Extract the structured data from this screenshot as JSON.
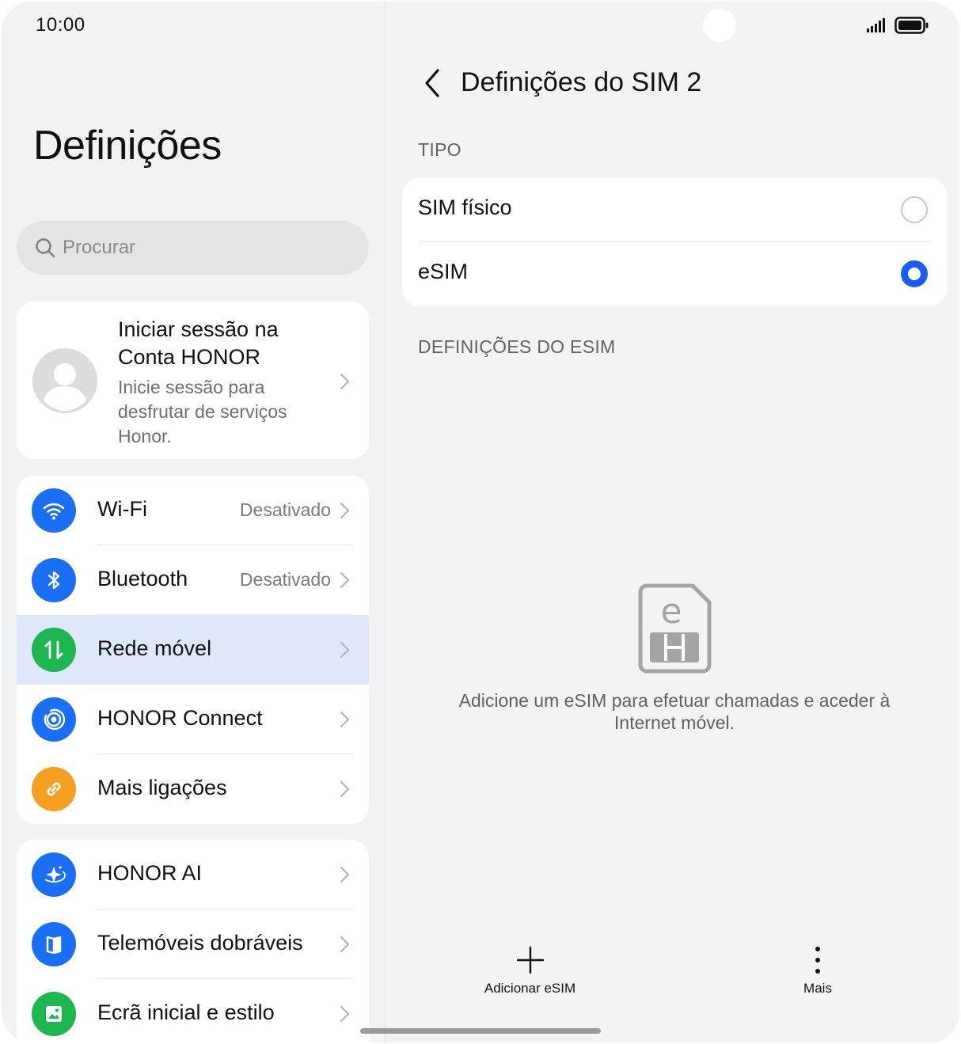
{
  "status_bar": {
    "time": "10:00",
    "signal_icon": "signal-icon",
    "battery_icon": "battery-icon"
  },
  "left": {
    "title": "Definições",
    "search": {
      "placeholder": "Procurar",
      "icon": "search-icon"
    },
    "account": {
      "title": "Iniciar sessão na Conta HONOR",
      "subtitle": "Inicie sessão para desfrutar de serviços Honor.",
      "icon": "avatar-icon"
    },
    "group1": [
      {
        "label": "Wi-Fi",
        "value": "Desativado",
        "icon": "wifi-icon",
        "color": "#1a6ff5"
      },
      {
        "label": "Bluetooth",
        "value": "Desativado",
        "icon": "bluetooth-icon",
        "color": "#1a6ff5"
      },
      {
        "label": "Rede móvel",
        "value": "",
        "icon": "mobile-data-icon",
        "color": "#1db650",
        "active": true
      },
      {
        "label": "HONOR Connect",
        "value": "",
        "icon": "honor-connect-icon",
        "color": "#1a6ff5"
      },
      {
        "label": "Mais ligações",
        "value": "",
        "icon": "link-icon",
        "color": "#f5a023"
      }
    ],
    "group2": [
      {
        "label": "HONOR AI",
        "icon": "honor-ai-icon",
        "color": "#1a6ff5"
      },
      {
        "label": "Telemóveis dobráveis",
        "icon": "foldable-icon",
        "color": "#1a6ff5"
      },
      {
        "label": "Ecrã inicial e estilo",
        "icon": "wallpaper-icon",
        "color": "#1db650"
      }
    ]
  },
  "right": {
    "title": "Definições do SIM 2",
    "type_section": "TIPO",
    "options": [
      {
        "label": "SIM físico",
        "selected": false
      },
      {
        "label": "eSIM",
        "selected": true
      }
    ],
    "esim_section": "DEFINIÇÕES DO ESIM",
    "empty_message": "Adicione um eSIM para efetuar chamadas e aceder à Internet móvel.",
    "actions": {
      "add": "Adicionar eSIM",
      "more": "Mais"
    },
    "accent_color": "#1a5cf0"
  }
}
